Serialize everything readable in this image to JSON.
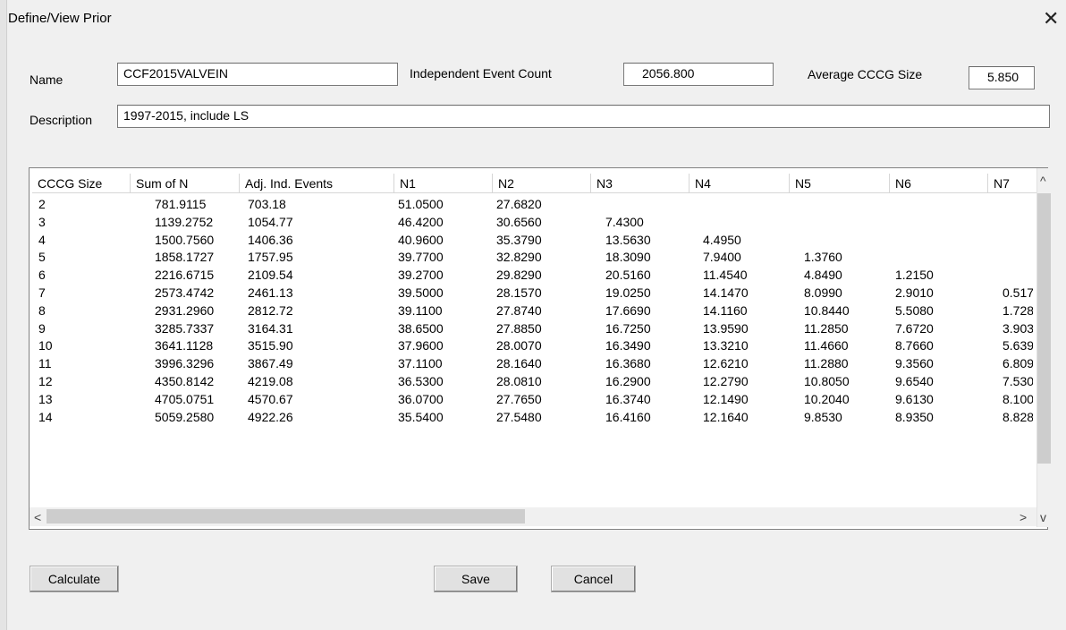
{
  "window": {
    "title": "Define/View Prior",
    "close_glyph": "✕"
  },
  "form": {
    "name_label": "Name",
    "name_value": "CCF2015VALVEIN",
    "iec_label": "Independent Event Count",
    "iec_value": "2056.800",
    "acs_label": "Average CCCG Size",
    "acs_value": "5.850",
    "desc_label": "Description",
    "desc_value": "1997-2015, include LS"
  },
  "table": {
    "columns": [
      "CCCG Size",
      "Sum of N",
      "Adj. Ind. Events",
      "N1",
      "N2",
      "N3",
      "N4",
      "N5",
      "N6",
      "N7"
    ],
    "rows": [
      [
        "2",
        "781.9115",
        "703.18",
        "51.0500",
        "27.6820",
        "",
        "",
        "",
        "",
        ""
      ],
      [
        "3",
        "1139.2752",
        "1054.77",
        "46.4200",
        "30.6560",
        "7.4300",
        "",
        "",
        "",
        ""
      ],
      [
        "4",
        "1500.7560",
        "1406.36",
        "40.9600",
        "35.3790",
        "13.5630",
        "4.4950",
        "",
        "",
        ""
      ],
      [
        "5",
        "1858.1727",
        "1757.95",
        "39.7700",
        "32.8290",
        "18.3090",
        "7.9400",
        "1.3760",
        "",
        ""
      ],
      [
        "6",
        "2216.6715",
        "2109.54",
        "39.2700",
        "29.8290",
        "20.5160",
        "11.4540",
        "4.8490",
        "1.2150",
        ""
      ],
      [
        "7",
        "2573.4742",
        "2461.13",
        "39.5000",
        "28.1570",
        "19.0250",
        "14.1470",
        "8.0990",
        "2.9010",
        "0.517"
      ],
      [
        "8",
        "2931.2960",
        "2812.72",
        "39.1100",
        "27.8740",
        "17.6690",
        "14.1160",
        "10.8440",
        "5.5080",
        "1.728"
      ],
      [
        "9",
        "3285.7337",
        "3164.31",
        "38.6500",
        "27.8850",
        "16.7250",
        "13.9590",
        "11.2850",
        "7.6720",
        "3.903"
      ],
      [
        "10",
        "3641.1128",
        "3515.90",
        "37.9600",
        "28.0070",
        "16.3490",
        "13.3210",
        "11.4660",
        "8.7660",
        "5.639"
      ],
      [
        "11",
        "3996.3296",
        "3867.49",
        "37.1100",
        "28.1640",
        "16.3680",
        "12.6210",
        "11.2880",
        "9.3560",
        "6.809"
      ],
      [
        "12",
        "4350.8142",
        "4219.08",
        "36.5300",
        "28.0810",
        "16.2900",
        "12.2790",
        "10.8050",
        "9.6540",
        "7.530"
      ],
      [
        "13",
        "4705.0751",
        "4570.67",
        "36.0700",
        "27.7650",
        "16.3740",
        "12.1490",
        "10.2040",
        "9.6130",
        "8.100"
      ],
      [
        "14",
        "5059.2580",
        "4922.26",
        "35.5400",
        "27.5480",
        "16.4160",
        "12.1640",
        "9.8530",
        "8.9350",
        "8.828"
      ]
    ]
  },
  "scrollbars": {
    "up_glyph": "^",
    "down_glyph": "v",
    "left_glyph": "<",
    "right_glyph": ">",
    "vertical_icon": "scroll-arrows",
    "horizontal_icon": "scroll-arrows"
  },
  "buttons": {
    "calculate": "Calculate",
    "save": "Save",
    "cancel": "Cancel"
  }
}
